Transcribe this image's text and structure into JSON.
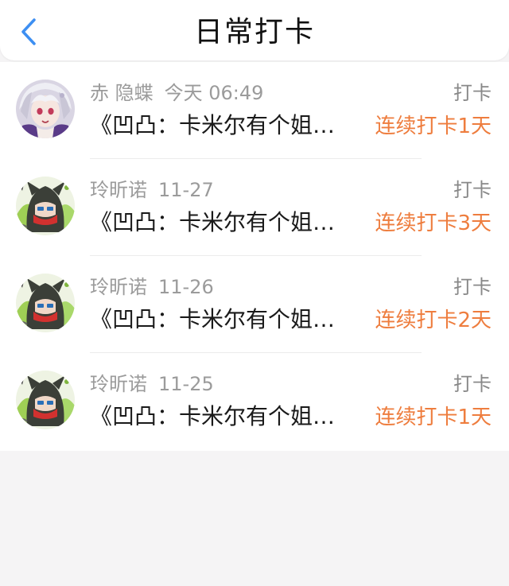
{
  "header": {
    "title": "日常打卡",
    "back_icon": "chevron-left-icon",
    "accent_color": "#3d8ff2"
  },
  "colors": {
    "streak": "#ee7d3e",
    "muted": "#9b9b9b"
  },
  "entries": [
    {
      "user": "赤 隐蝶",
      "time": "今天 06:49",
      "action": "打卡",
      "content": "《凹凸：卡米尔有个姐…",
      "streak": "连续打卡1天",
      "avatar": "white-hair-avatar"
    },
    {
      "user": "玲昕诺",
      "time": "11-27",
      "action": "打卡",
      "content": "《凹凸：卡米尔有个姐…",
      "streak": "连续打卡3天",
      "avatar": "green-hood-avatar"
    },
    {
      "user": "玲昕诺",
      "time": "11-26",
      "action": "打卡",
      "content": "《凹凸：卡米尔有个姐…",
      "streak": "连续打卡2天",
      "avatar": "green-hood-avatar"
    },
    {
      "user": "玲昕诺",
      "time": "11-25",
      "action": "打卡",
      "content": "《凹凸：卡米尔有个姐…",
      "streak": "连续打卡1天",
      "avatar": "green-hood-avatar"
    }
  ]
}
